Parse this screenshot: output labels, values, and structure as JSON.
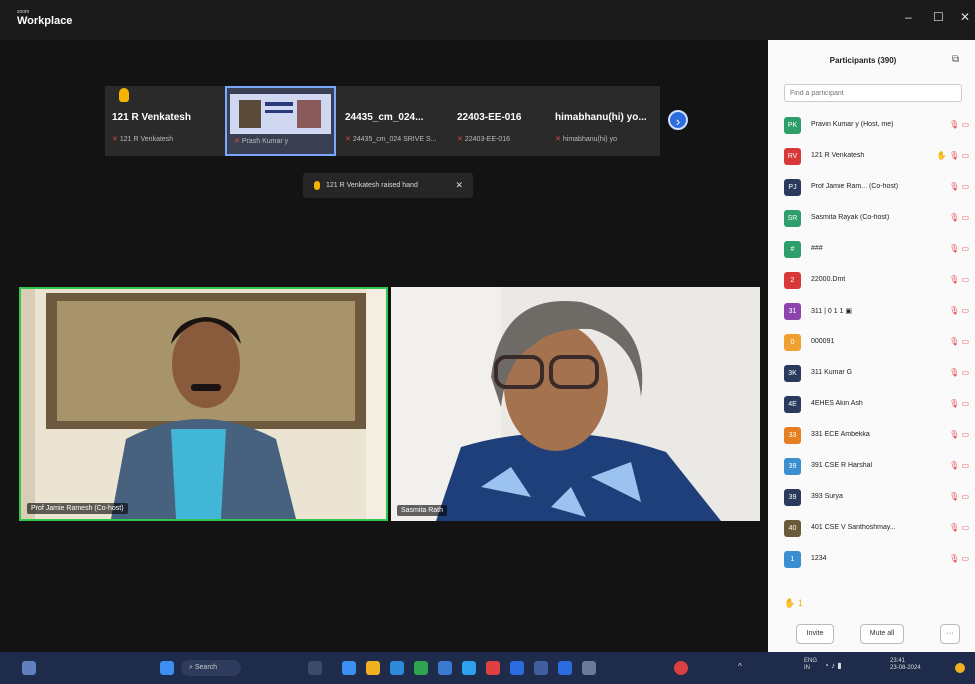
{
  "window": {
    "app_name_small": "zoom",
    "app_name": "Workplace",
    "controls": [
      "–",
      "☐",
      "✕"
    ]
  },
  "strip": {
    "tiles": [
      {
        "name": "121 R Venkatesh",
        "sub": "121 R Venkatesh",
        "raised_hand": true
      },
      {
        "name": "",
        "sub": "Prash Kumar y",
        "screen": true
      },
      {
        "name": "24435_cm_024...",
        "sub": "24435_cm_024 SRIVE S..."
      },
      {
        "name": "22403-EE-016",
        "sub": "22403-EE-016"
      },
      {
        "name": "himabhanu(hi) yo...",
        "sub": "himabhanu(hi) yo"
      }
    ],
    "next_icon": "›"
  },
  "toast": {
    "text": "121 R Venkatesh raised hand",
    "close": "✕"
  },
  "videos": [
    {
      "label": "Prof Jamie Ramesh (Co-host)"
    },
    {
      "label": "Sasmita Rath"
    }
  ],
  "panel": {
    "title": "Participants (390)",
    "popout_icon": "⧉",
    "search_placeholder": "Find a participant",
    "participants": [
      {
        "name": "Pravin Kumar y (Host, me)",
        "initials": "PK",
        "color": "#2e9e6b",
        "hand": false,
        "icons": "🎙 ▭"
      },
      {
        "name": "121 R Venkatesh",
        "initials": "RV",
        "color": "#d93838",
        "hand": true,
        "icons": "🎙 ▭"
      },
      {
        "name": "Prof Jamie Ram... (Co-host)",
        "initials": "PJ",
        "color": "#2a3a5c",
        "hand": false,
        "icons": "🎙 ▭"
      },
      {
        "name": "Sasmita Rayak (Co-host)",
        "initials": "SR",
        "color": "#2e9e6b",
        "hand": false,
        "icons": "🎙 ▭"
      },
      {
        "name": "###",
        "initials": "#",
        "color": "#2e9e6b",
        "hand": false,
        "icons": "🎙 ▭"
      },
      {
        "name": "22000.Dmt",
        "initials": "2",
        "color": "#d93838",
        "hand": false,
        "icons": "🎙 ▭"
      },
      {
        "name": "311 | 0 1 1 ▣",
        "initials": "31",
        "color": "#8e44ad",
        "hand": false,
        "icons": "🎙 ▭"
      },
      {
        "name": "000091",
        "initials": "0",
        "color": "#f0a030",
        "hand": false,
        "icons": "🎙 ▭"
      },
      {
        "name": "311 Kumar G",
        "initials": "3K",
        "color": "#2a3a5c",
        "hand": false,
        "icons": "🎙 ▭"
      },
      {
        "name": "4EHES Akin Ash",
        "initials": "4E",
        "color": "#2a3a5c",
        "hand": false,
        "icons": "🎙 ▭"
      },
      {
        "name": "331 ECE Ambekka",
        "initials": "33",
        "color": "#e67e22",
        "hand": false,
        "icons": "🎙 ▭"
      },
      {
        "name": "391 CSE R Harshal",
        "initials": "39",
        "color": "#3b8fd0",
        "hand": false,
        "icons": "🎙 ▭"
      },
      {
        "name": "393 Surya",
        "initials": "39",
        "color": "#2a3a5c",
        "hand": false,
        "icons": "🎙 ▭"
      },
      {
        "name": "401 CSE V Santhoshmay...",
        "initials": "40",
        "color": "#6b5b3a",
        "hand": false,
        "icons": "🎙 ▭"
      },
      {
        "name": "1234",
        "initials": "1",
        "color": "#3b8fd0",
        "hand": false,
        "icons": "🎙 ▭"
      }
    ],
    "reactions": "✋ 1",
    "invite_label": "Invite",
    "mute_all_label": "Mute all",
    "more_label": "···"
  },
  "taskbar": {
    "search_label": "Search",
    "time": "23:41",
    "date": "23-08-2024",
    "lang_top": "ENG",
    "lang_bottom": "IN"
  }
}
